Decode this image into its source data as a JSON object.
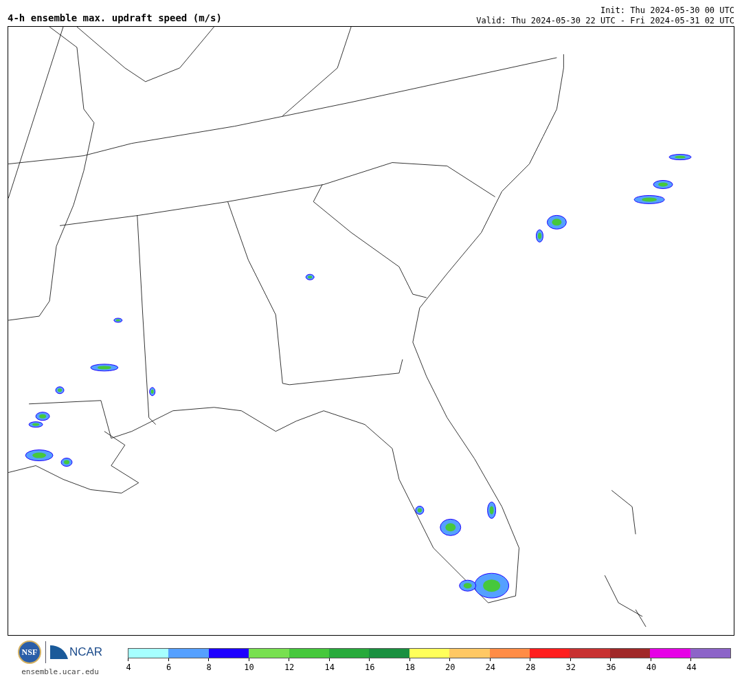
{
  "title": "4-h ensemble max. updraft speed (m/s)",
  "init": "Init: Thu 2024-05-30 00 UTC",
  "valid": "Valid: Thu 2024-05-30 22 UTC - Fri 2024-05-31 02 UTC",
  "logos": {
    "nsf": "NSF",
    "ncar": "NCAR",
    "url": "ensemble.ucar.edu"
  },
  "colorbar": [
    {
      "color": "#a6ffff",
      "label": "4"
    },
    {
      "color": "#55a0ff",
      "label": "6"
    },
    {
      "color": "#1e00ff",
      "label": "8"
    },
    {
      "color": "#78e050",
      "label": "10"
    },
    {
      "color": "#46c83c",
      "label": "12"
    },
    {
      "color": "#28aa3c",
      "label": "14"
    },
    {
      "color": "#1a9040",
      "label": "16"
    },
    {
      "color": "#ffff5a",
      "label": "18"
    },
    {
      "color": "#ffc864",
      "label": "20"
    },
    {
      "color": "#ff8c46",
      "label": "24"
    },
    {
      "color": "#ff1e1e",
      "label": "28"
    },
    {
      "color": "#c83232",
      "label": "32"
    },
    {
      "color": "#a02828",
      "label": "36"
    },
    {
      "color": "#e600e6",
      "label": "40"
    },
    {
      "color": "#8c64c8",
      "label": "44"
    }
  ]
}
